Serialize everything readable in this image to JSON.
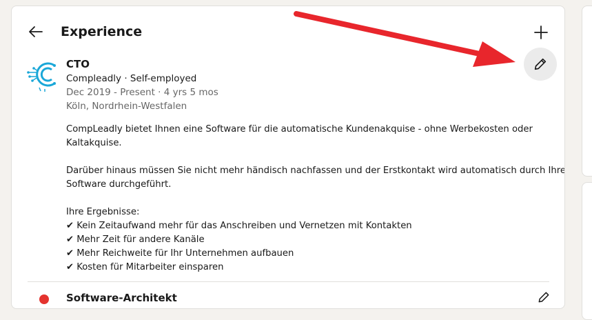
{
  "card": {
    "title": "Experience"
  },
  "colors": {
    "accent_logo": "#1aa7d8",
    "annotation_arrow": "#e8262c",
    "edit_button_bg": "#ebebeb",
    "muted_text": "#666666"
  },
  "icons": {
    "back": "arrow-left-icon",
    "add": "plus-icon",
    "edit": "pencil-icon"
  },
  "experience": [
    {
      "title": "CTO",
      "company": "Compleadly · Self-employed",
      "dates": "Dec 2019 - Present · 4 yrs 5 mos",
      "location": "Köln, Nordrhein-Westfalen",
      "description": {
        "p1_l1": "CompLeadly bietet Ihnen eine Software für die automatische Kundenakquise - ohne Werbekosten oder",
        "p1_l2": "Kaltakquise.",
        "p2_l1": "Darüber hinaus müssen Sie nicht mehr händisch nachfassen und der Erstkontakt wird automatisch durch Ihre",
        "p2_l2": "Software durchgeführt.",
        "p3_heading": "Ihre Ergebnisse:",
        "bullets": [
          "✔ Kein Zeitaufwand mehr für das Anschreiben und Vernetzen mit Kontakten",
          "✔ Mehr Zeit für andere Kanäle",
          "✔ Mehr Reichweite für Ihr Unternehmen aufbauen",
          "✔ Kosten für Mitarbeiter einsparen"
        ]
      }
    },
    {
      "title": "Software-Architekt"
    }
  ]
}
